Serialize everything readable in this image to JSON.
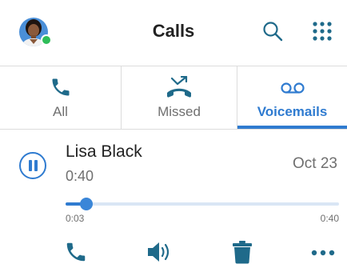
{
  "header": {
    "title": "Calls",
    "avatar_icon": "person-avatar",
    "presence_status": "available",
    "search_icon": "search-icon",
    "apps_icon": "grid-icon"
  },
  "tabs": [
    {
      "label": "All",
      "icon": "phone-icon",
      "active": false
    },
    {
      "label": "Missed",
      "icon": "missed-call-icon",
      "active": false
    },
    {
      "label": "Voicemails",
      "icon": "voicemail-icon",
      "active": true
    }
  ],
  "voicemail": {
    "caller": "Lisa Black",
    "duration": "0:40",
    "date": "Oct 23",
    "playback": {
      "state": "playing",
      "current_time": "0:03",
      "total_time": "0:40",
      "progress": 0.075
    },
    "actions": [
      {
        "name": "call",
        "icon": "phone-icon"
      },
      {
        "name": "speaker",
        "icon": "speaker-icon"
      },
      {
        "name": "delete",
        "icon": "trash-icon"
      },
      {
        "name": "more",
        "icon": "more-icon"
      }
    ]
  },
  "colors": {
    "accent": "#2f7bd0",
    "presence": "#2ebd59",
    "text_primary": "#222222",
    "text_secondary": "#6f6f6f",
    "icon_teal": "#1f6a8a"
  }
}
